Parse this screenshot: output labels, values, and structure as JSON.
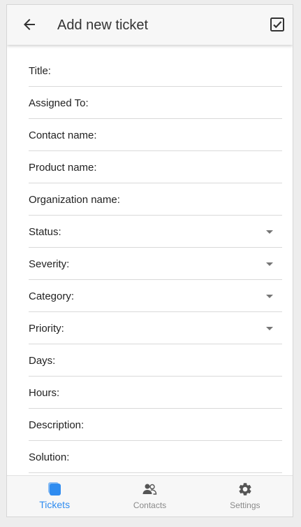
{
  "header": {
    "title": "Add new ticket",
    "back_icon": "arrow-left-icon",
    "save_icon": "checkbox-check-icon",
    "background": "#f7f7f7"
  },
  "form": {
    "fields": [
      {
        "label": "Title:",
        "dropdown": false
      },
      {
        "label": "Assigned To:",
        "dropdown": false
      },
      {
        "label": "Contact name:",
        "dropdown": false
      },
      {
        "label": "Product name:",
        "dropdown": false
      },
      {
        "label": "Organization name:",
        "dropdown": false
      },
      {
        "label": "Status:",
        "dropdown": true
      },
      {
        "label": "Severity:",
        "dropdown": true
      },
      {
        "label": "Category:",
        "dropdown": true
      },
      {
        "label": "Priority:",
        "dropdown": true
      },
      {
        "label": "Days:",
        "dropdown": false
      },
      {
        "label": "Hours:",
        "dropdown": false
      },
      {
        "label": "Description:",
        "dropdown": false
      },
      {
        "label": "Solution:",
        "dropdown": false
      }
    ]
  },
  "tabbar": {
    "tabs": [
      {
        "label": "Tickets",
        "icon": "tickets-icon",
        "active": true
      },
      {
        "label": "Contacts",
        "icon": "contacts-icon",
        "active": false
      },
      {
        "label": "Settings",
        "icon": "gear-icon",
        "active": false
      }
    ]
  },
  "colors": {
    "accent": "#2f8cf0",
    "inactive": "#8a8a8a",
    "icon_inactive": "#555555",
    "divider": "#d9d9d9"
  }
}
